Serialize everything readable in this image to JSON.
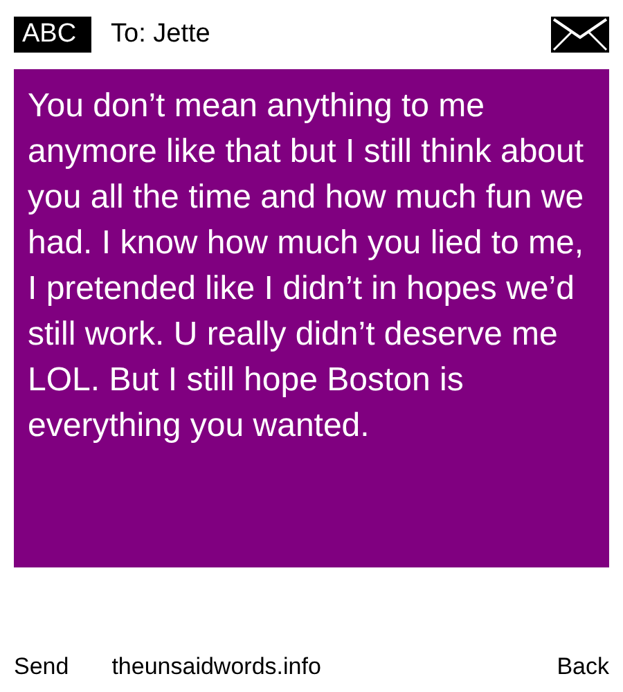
{
  "header": {
    "mode": "ABC",
    "recipient": "To: Jette"
  },
  "message": {
    "text": "You don’t mean anything to me anymore like that but I still think about you all the time and how much fun we had. I know how much you lied to me, I pretended like I didn’t in hopes we’d still work. U really didn’t deserve me LOL. But I still hope Boston is everything you wanted."
  },
  "footer": {
    "left": "Send",
    "site": "theunsaidwords.info",
    "right": "Back"
  }
}
